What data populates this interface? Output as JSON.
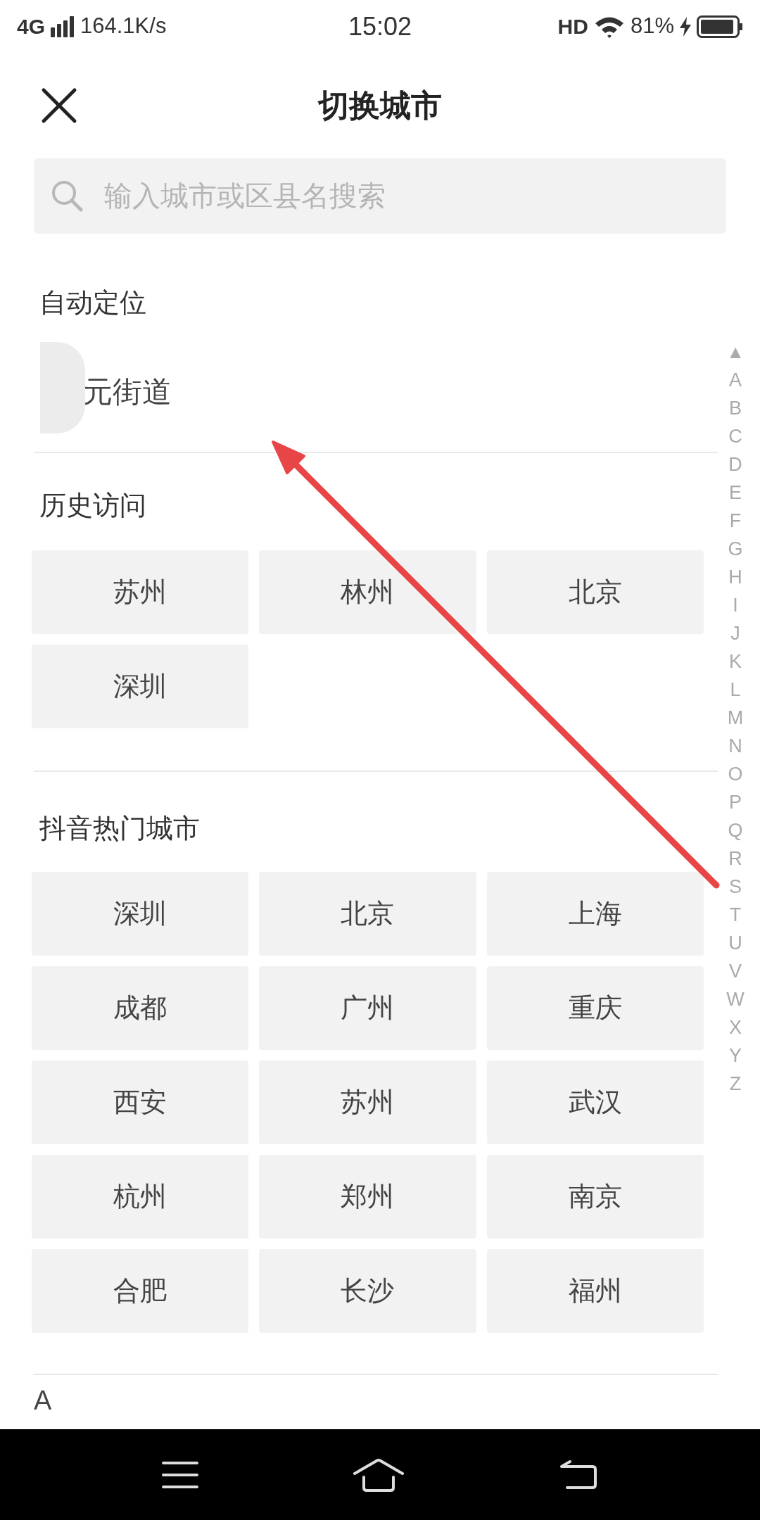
{
  "status_bar": {
    "network": "4G",
    "speed": "164.1K/s",
    "time": "15:02",
    "hd": "HD",
    "battery": "81%"
  },
  "header": {
    "title": "切换城市"
  },
  "search": {
    "placeholder": "输入城市或区县名搜索"
  },
  "auto_location": {
    "label": "自动定位",
    "place": "元街道"
  },
  "history": {
    "label": "历史访问",
    "cities": [
      "苏州",
      "林州",
      "北京",
      "深圳"
    ]
  },
  "hot": {
    "label": "抖音热门城市",
    "cities": [
      "深圳",
      "北京",
      "上海",
      "成都",
      "广州",
      "重庆",
      "西安",
      "苏州",
      "武汉",
      "杭州",
      "郑州",
      "南京",
      "合肥",
      "长沙",
      "福州"
    ]
  },
  "section_a": {
    "label": "A"
  },
  "index_bar": {
    "top": "▲",
    "letters": [
      "A",
      "B",
      "C",
      "D",
      "E",
      "F",
      "G",
      "H",
      "I",
      "J",
      "K",
      "L",
      "M",
      "N",
      "O",
      "P",
      "Q",
      "R",
      "S",
      "T",
      "U",
      "V",
      "W",
      "X",
      "Y",
      "Z"
    ]
  }
}
